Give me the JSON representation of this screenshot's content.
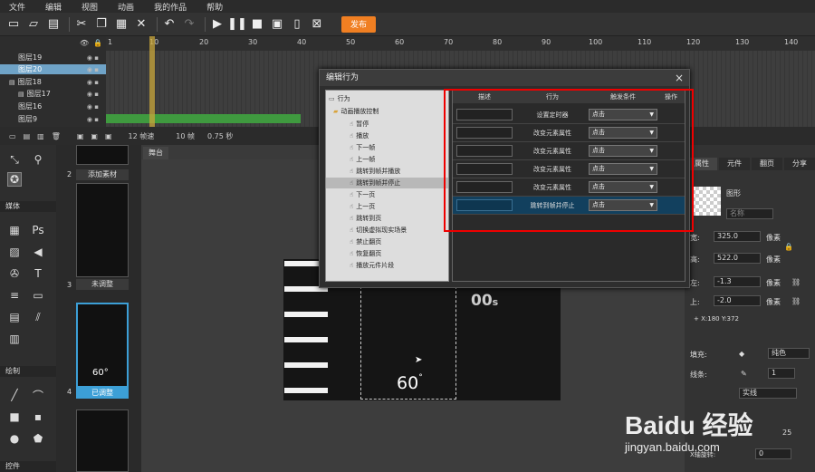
{
  "menu": [
    "文件",
    "编辑",
    "视图",
    "动画",
    "我的作品",
    "帮助"
  ],
  "toolbar": {
    "publish_label": "发布"
  },
  "timeline": {
    "ticks": [
      "1",
      "10",
      "20",
      "30",
      "40",
      "50",
      "60",
      "70",
      "80",
      "90",
      "100",
      "110",
      "120",
      "130",
      "140"
    ],
    "layers": [
      "图层19",
      "图层20",
      "图层18",
      "图层17",
      "图层16",
      "图层9"
    ],
    "fps": "12 帧速",
    "frames": "10 帧",
    "seconds": "0.75 秒"
  },
  "tools": {
    "media_label": "媒体",
    "draw_label": "绘制",
    "controls_label": "控件"
  },
  "pages": [
    {
      "num": "2",
      "label": "添加素材"
    },
    {
      "num": "3",
      "label": "未调整"
    },
    {
      "num": "4",
      "label": "已调整"
    }
  ],
  "stage": {
    "tab": "舞台",
    "number1": "00",
    "number1_unit": "s",
    "number2": "60",
    "number2_unit": "°"
  },
  "props": {
    "tabs": [
      "属性",
      "元件",
      "翻页",
      "分享"
    ],
    "shape_label": "图形",
    "name_placeholder": "名称",
    "width_label": "宽:",
    "width_value": "325.0",
    "height_label": "高:",
    "height_value": "522.0",
    "left_label": "左:",
    "left_value": "-1.3",
    "top_label": "上:",
    "top_value": "-2.0",
    "unit": "像素",
    "coords": "+ X:180  Y:372",
    "fill_label": "填充:",
    "fill_value": "纯色",
    "stroke_label": "线条:",
    "stroke_value": "1",
    "line_type": "实线",
    "num_25": "25",
    "x_rotate_label": "X轴旋转:",
    "x_rotate_value": "0"
  },
  "dialog": {
    "title": "编辑行为",
    "tree_root": "行为",
    "tree_group": "动画播放控制",
    "tree_items": [
      "暂停",
      "播放",
      "下一帧",
      "上一帧",
      "跳转到帧并播放",
      "跳转到帧并停止",
      "下一页",
      "上一页",
      "跳转到页",
      "切换虚拟现实场景",
      "禁止翻页",
      "恢复翻页",
      "播放元件片段"
    ],
    "selected_item_index": 5,
    "columns": [
      "描述",
      "行为",
      "触发条件",
      "操作"
    ],
    "rows": [
      {
        "action": "设置定时器",
        "trigger": "点击"
      },
      {
        "action": "改变元素属性",
        "trigger": "点击"
      },
      {
        "action": "改变元素属性",
        "trigger": "点击"
      },
      {
        "action": "改变元素属性",
        "trigger": "点击"
      },
      {
        "action": "改变元素属性",
        "trigger": "点击"
      },
      {
        "action": "跳转到帧并停止",
        "trigger": "点击"
      }
    ],
    "selected_row_index": 5
  },
  "watermark": {
    "brand": "Baidu 经验",
    "url": "jingyan.baidu.com"
  },
  "colors": {
    "accent": "#f07f22",
    "highlight_row": "#12405e",
    "annotation": "#e00000",
    "selected_layer": "#6fa3c7"
  }
}
